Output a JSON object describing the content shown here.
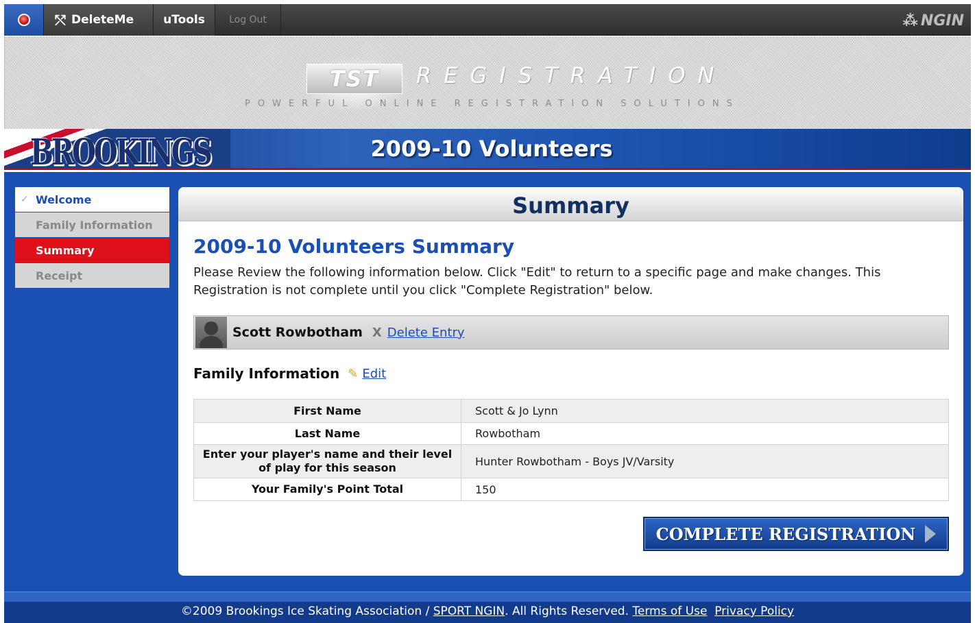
{
  "topbar": {
    "home_icon": "red-dot-icon",
    "deleteme_icon": "network-icon",
    "deleteme_label": "DeleteMe",
    "utools_label": "uTools",
    "logout_label": "Log Out",
    "ngin_label": "NGIN"
  },
  "banner": {
    "logo_text": "TST",
    "title": "REGISTRATION",
    "tagline": "POWERFUL ONLINE REGISTRATION SOLUTIONS"
  },
  "team": {
    "logo_text": "BROOKINGS",
    "title": "2009-10 Volunteers"
  },
  "nav": {
    "items": [
      {
        "label": "Welcome",
        "state": "completed"
      },
      {
        "label": "Family Information",
        "state": "pending"
      },
      {
        "label": "Summary",
        "state": "active"
      },
      {
        "label": "Receipt",
        "state": "pending"
      }
    ]
  },
  "panel": {
    "header": "Summary",
    "title": "2009-10 Volunteers Summary",
    "intro": "Please Review the following information below. Click \"Edit\" to return to a specific page and make changes. This Registration is not complete until you click \"Complete Registration\" below.",
    "entry": {
      "name": "Scott Rowbotham",
      "x_mark": "X",
      "delete_label": "Delete Entry"
    },
    "family": {
      "heading": "Family Information",
      "edit_label": "Edit",
      "rows": [
        {
          "key": "First Name",
          "value": "Scott & Jo Lynn"
        },
        {
          "key": "Last Name",
          "value": "Rowbotham"
        },
        {
          "key": "Enter your player's name and their level of play for this season",
          "value": "Hunter Rowbotham - Boys JV/Varsity"
        },
        {
          "key": "Your Family's Point Total",
          "value": "150"
        }
      ]
    },
    "complete_label": "COMPLETE REGISTRATION"
  },
  "footer": {
    "copyright": "©2009 Brookings Ice Skating Association / ",
    "sport_ngin": "SPORT NGIN",
    "rights": ". All Rights Reserved. ",
    "terms": "Terms of Use",
    "privacy": "Privacy Policy"
  },
  "colors": {
    "brand_blue": "#1a4fb3",
    "active_red": "#e0101a",
    "topbar": "#3a3a3a"
  }
}
